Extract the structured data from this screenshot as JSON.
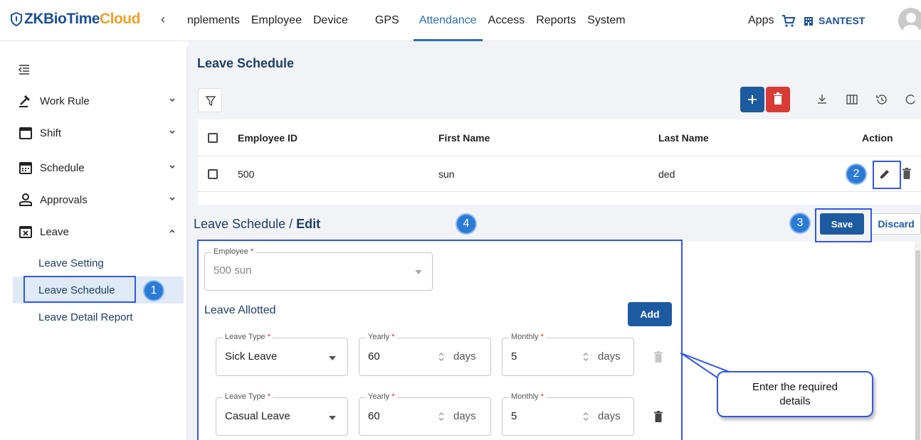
{
  "app": {
    "logo_brand": "ZKBioTime",
    "logo_suffix": "Cloud"
  },
  "nav": {
    "items": [
      "nplements",
      "Employee",
      "Device",
      "GPS",
      "Attendance",
      "Access",
      "Reports",
      "System"
    ],
    "active": "Attendance",
    "apps_label": "Apps",
    "org_label": "SANTEST"
  },
  "sidebar": {
    "groups": [
      {
        "label": "Work Rule",
        "icon": "gavel-icon",
        "expanded": false
      },
      {
        "label": "Shift",
        "icon": "calendar-blank-icon",
        "expanded": false
      },
      {
        "label": "Schedule",
        "icon": "calendar-grid-icon",
        "expanded": false
      },
      {
        "label": "Approvals",
        "icon": "person-check-icon",
        "expanded": false
      },
      {
        "label": "Leave",
        "icon": "calendar-x-icon",
        "expanded": true
      }
    ],
    "leave_sub": [
      "Leave Setting",
      "Leave Schedule",
      "Leave Detail Report"
    ],
    "selected_sub": "Leave Schedule"
  },
  "grid": {
    "title": "Leave Schedule",
    "columns": [
      "Employee ID",
      "First Name",
      "Last Name",
      "Action"
    ],
    "rows": [
      {
        "employee_id": "500",
        "first_name": "sun",
        "last_name": "ded"
      }
    ]
  },
  "edit": {
    "breadcrumb_parent": "Leave Schedule",
    "breadcrumb_sep": "/",
    "breadcrumb_current": "Edit",
    "save_label": "Save",
    "discard_label": "Discard",
    "employee_label": "Employee",
    "employee_value": "500 sun",
    "section_title": "Leave Allotted",
    "add_label": "Add",
    "leave_type_label": "Leave Type",
    "yearly_label": "Yearly",
    "monthly_label": "Monthly",
    "unit_label": "days",
    "required_mark": "*",
    "rows": [
      {
        "leave_type": "Sick Leave",
        "yearly": "60",
        "monthly": "5"
      },
      {
        "leave_type": "Casual Leave",
        "yearly": "60",
        "monthly": "5"
      }
    ]
  },
  "annotations": {
    "badges": [
      "1",
      "2",
      "3",
      "4"
    ],
    "callout": "Enter the required details",
    "color": "#3357e6"
  },
  "colors": {
    "primary": "#1d5aa0",
    "danger": "#d83a35",
    "active_nav": "#2a6fb0",
    "brand_orange": "#f0a22a"
  }
}
